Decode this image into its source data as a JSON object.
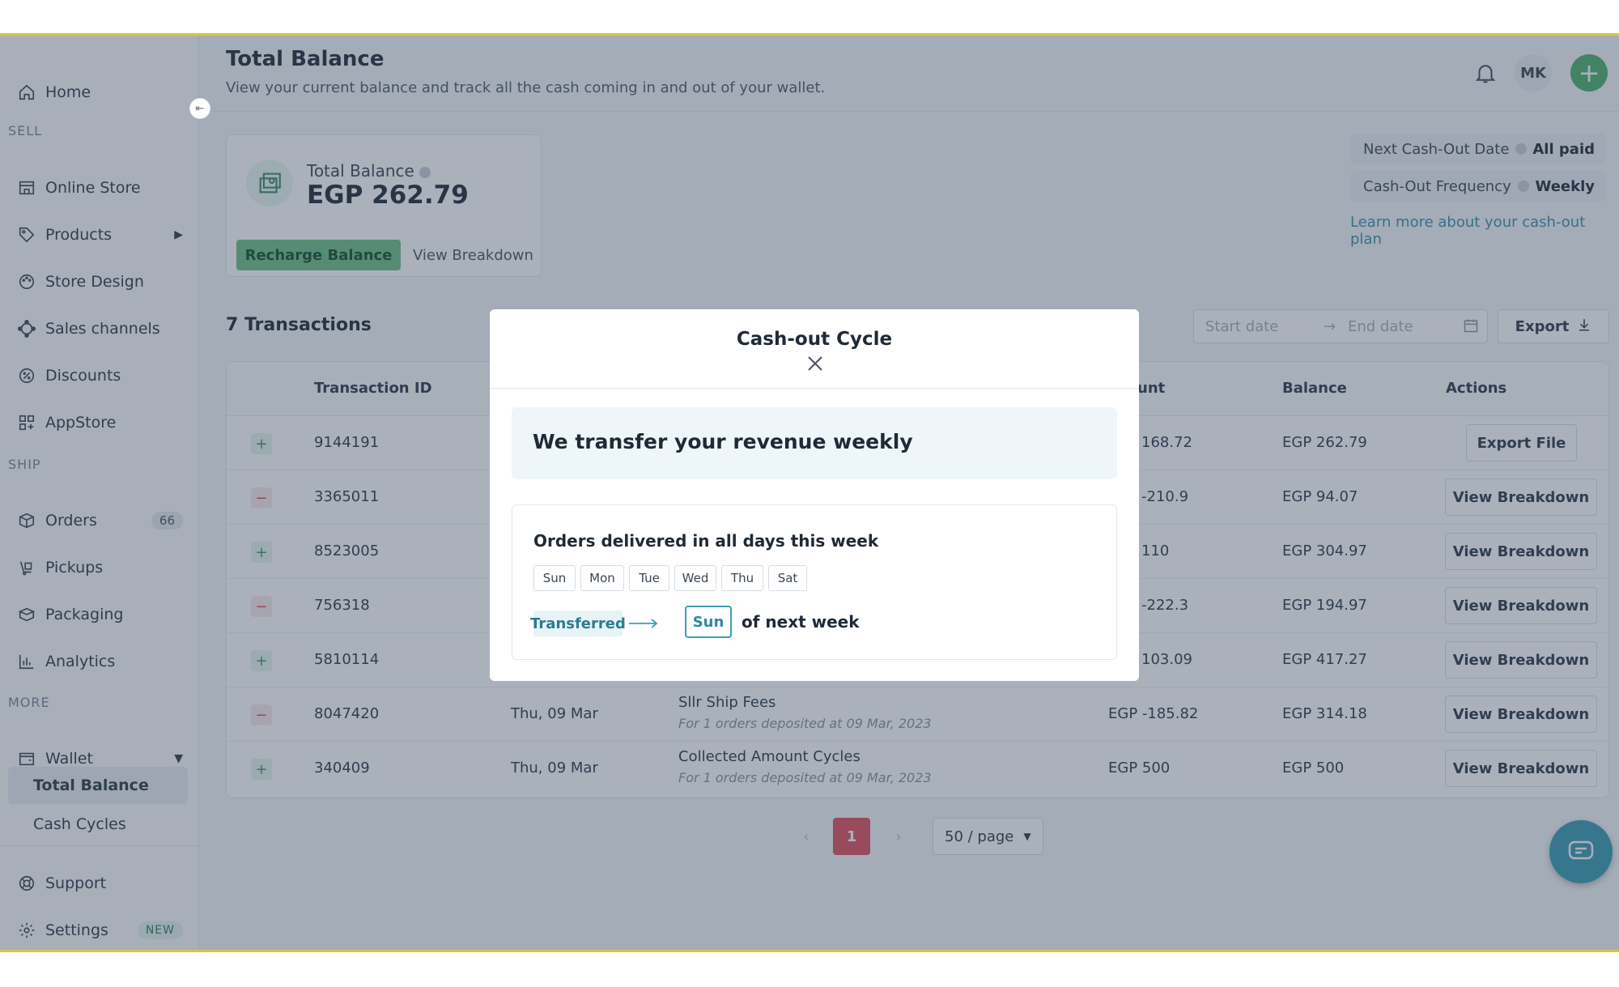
{
  "sidebar": {
    "home": "Home",
    "sell_label": "SELL",
    "online_store": "Online Store",
    "products": "Products",
    "store_design": "Store Design",
    "sales_channels": "Sales channels",
    "discounts": "Discounts",
    "appstore": "AppStore",
    "ship_label": "SHIP",
    "orders": "Orders",
    "orders_count": "66",
    "pickups": "Pickups",
    "packaging": "Packaging",
    "analytics": "Analytics",
    "more_label": "MORE",
    "wallet": "Wallet",
    "total_balance": "Total Balance",
    "cash_cycles": "Cash Cycles",
    "support": "Support",
    "settings": "Settings",
    "settings_badge": "NEW"
  },
  "header": {
    "title": "Total Balance",
    "subtitle": "View your current balance and track all the cash coming in and out of your wallet.",
    "avatar_initials": "MK",
    "add_symbol": "+"
  },
  "balance": {
    "label": "Total Balance",
    "value": "EGP 262.79",
    "recharge": "Recharge Balance",
    "view_breakdown": "View Breakdown"
  },
  "cashout": {
    "next_date_label": "Next Cash-Out Date",
    "next_date_value": "All paid",
    "frequency_label": "Cash-Out Frequency",
    "frequency_value": "Weekly",
    "learn_more": "Learn more about your cash-out plan"
  },
  "transactions": {
    "title": "7 Transactions",
    "start_placeholder": "Start date",
    "end_placeholder": "End date",
    "export": "Export",
    "columns": [
      "Transaction ID",
      "unt",
      "Balance",
      "Actions"
    ],
    "rows": [
      {
        "sign": "+",
        "id": "9144191",
        "date": "",
        "desc": "",
        "desc2": "",
        "amount": "168.72",
        "balance": "EGP 262.79",
        "action": "Export File"
      },
      {
        "sign": "−",
        "id": "3365011",
        "date": "",
        "desc": "",
        "desc2": "",
        "amount": "-210.9",
        "balance": "EGP 94.07",
        "action": "View Breakdown"
      },
      {
        "sign": "+",
        "id": "8523005",
        "date": "",
        "desc": "",
        "desc2": "",
        "amount": "110",
        "balance": "EGP 304.97",
        "action": "View Breakdown"
      },
      {
        "sign": "−",
        "id": "756318",
        "date": "",
        "desc": "",
        "desc2": "",
        "amount": "-222.3",
        "balance": "EGP 194.97",
        "action": "View Breakdown"
      },
      {
        "sign": "+",
        "id": "5810114",
        "date": "",
        "desc": "",
        "desc2": "",
        "amount": "103.09",
        "balance": "EGP 417.27",
        "action": "View Breakdown"
      },
      {
        "sign": "−",
        "id": "8047420",
        "date": "Thu, 09 Mar",
        "desc": "Sllr Ship Fees",
        "desc2": "For 1 orders deposited at 09 Mar, 2023",
        "amount": "EGP -185.82",
        "balance": "EGP 314.18",
        "action": "View Breakdown"
      },
      {
        "sign": "+",
        "id": "340409",
        "date": "Thu, 09 Mar",
        "desc": "Collected Amount Cycles",
        "desc2": "For 1 orders deposited at 09 Mar, 2023",
        "amount": "EGP 500",
        "balance": "EGP 500",
        "action": "View Breakdown"
      }
    ]
  },
  "pagination": {
    "prev": "‹",
    "current": "1",
    "next": "›",
    "page_size": "50 / page"
  },
  "modal": {
    "title": "Cash-out Cycle",
    "banner": "We transfer your revenue weekly",
    "heading": "Orders delivered in all days this week",
    "days": [
      "Sun",
      "Mon",
      "Tue",
      "Wed",
      "Thu",
      "Sat"
    ],
    "transferred": "Transferred",
    "transfer_day": "Sun",
    "suffix": "of next week"
  }
}
